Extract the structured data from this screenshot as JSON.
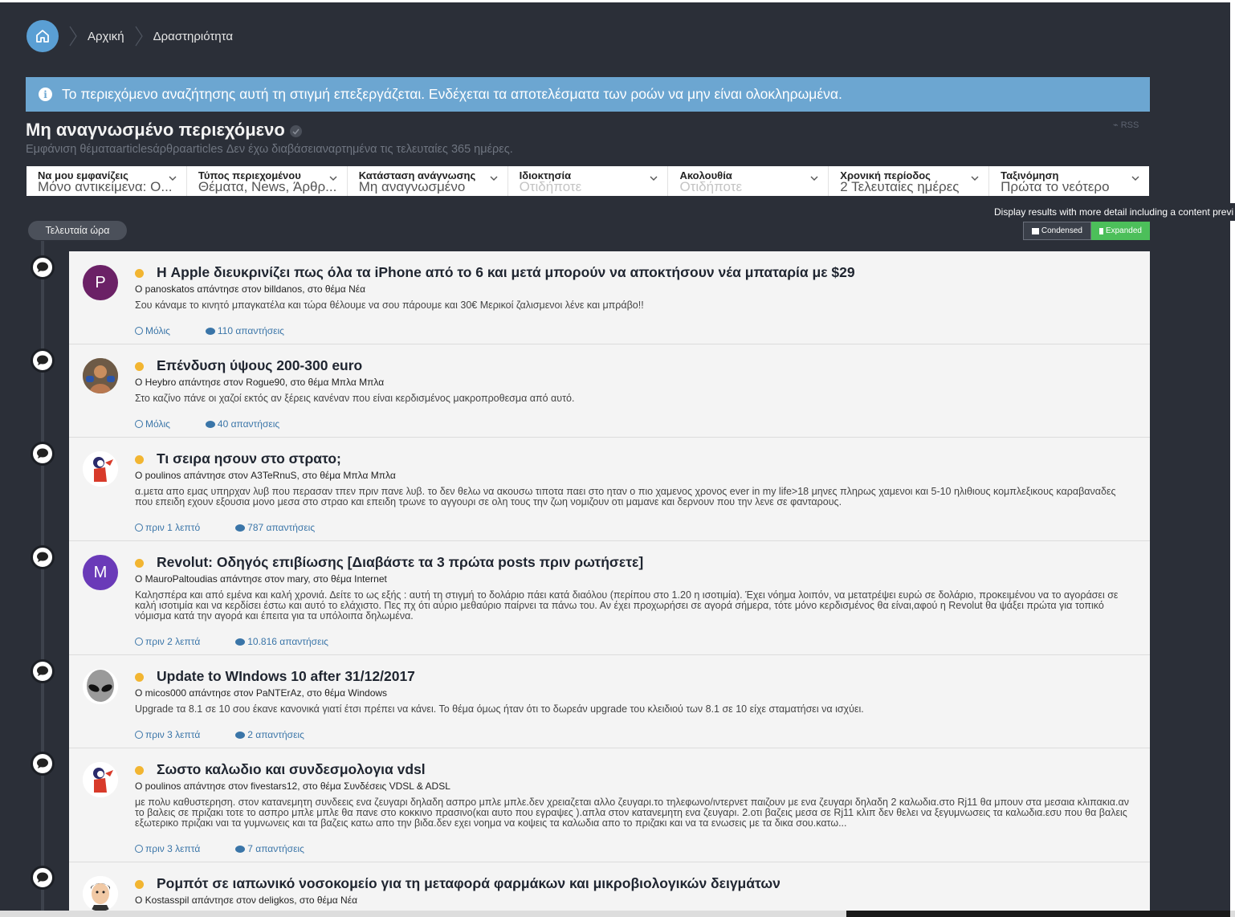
{
  "breadcrumb": {
    "home_icon": "home-icon",
    "items": [
      "Αρχική",
      "Δραστηριότητα"
    ]
  },
  "notice": {
    "icon": "info-icon",
    "text": "Το περιεχόμενο αναζήτησης αυτή τη στιγμή επεξεργάζεται. Ενδέχεται τα αποτελέσματα των ροών να μην είναι ολοκληρωμένα."
  },
  "page": {
    "title": "Μη αναγνωσμένο περιεχόμενο",
    "rss": "RSS",
    "subtitle": "Εμφάνιση θέματαarticlesάρθραarticles Δεν έχω διαβάσειαναρτημένα τις τελευταίες 365 ημέρες."
  },
  "filters": [
    {
      "label": "Να μου εμφανίζεις",
      "value": "Μόνο αντικείμενα: Ο...",
      "muted": false
    },
    {
      "label": "Τύπος περιεχομένου",
      "value": "Θέματα, News, Άρθρ...",
      "muted": false
    },
    {
      "label": "Κατάσταση ανάγνωσης",
      "value": "Μη αναγνωσμένο",
      "muted": false
    },
    {
      "label": "Ιδιοκτησία",
      "value": "Οτιδήποτε",
      "muted": true
    },
    {
      "label": "Ακολουθία",
      "value": "Οτιδήποτε",
      "muted": true
    },
    {
      "label": "Χρονική περίοδος",
      "value": "2 Τελευταίες ημέρες",
      "muted": false
    },
    {
      "label": "Ταξινόμηση",
      "value": "Πρώτα το νεότερο",
      "muted": false
    }
  ],
  "tooltip": "Display results with more detail including a content previ",
  "view_toggle": {
    "condensed": "Condensed",
    "expanded": "Expanded",
    "active": "expanded"
  },
  "time_group": "Τελευταία ώρα",
  "colors": {
    "accent": "#5a9fd4",
    "unread": "#f2b531",
    "link": "#3a75a8",
    "expanded": "#4cbf5a"
  },
  "items": [
    {
      "avatar_letter": "P",
      "avatar_color": "#6b2166",
      "title": "Η Apple διευκρινίζει πως όλα τα iPhone από το 6 και μετά μπορούν να αποκτήσουν νέα μπαταρία με $29",
      "meta": "Ο panoskatos απάντησε στον billdanos, στο θέμα Νέα",
      "snippet": "Σου κάναμε το κινητό μπαγκατέλα και τώρα θέλουμε να σου πάρουμε και 30€ Μερικοί ζαλισμενοι λένε και μπράβο!!",
      "time": "Μόλις",
      "replies": "110 απαντήσεις"
    },
    {
      "avatar_letter": "",
      "avatar_color": "#8a6a4a",
      "avatar_icon": "user-photo-icon",
      "title": "Επένδυση ύψους 200-300 euro",
      "meta": "Ο Heybro απάντησε στον Rogue90, στο θέμα Μπλα Μπλα",
      "snippet": "Στο καζίνο πάνε οι χαζοί εκτός αν ξέρεις κανέναν που είναι κερδισμένος μακροπροθεσμα από αυτό.",
      "time": "Μόλις",
      "replies": "40 απαντήσεις"
    },
    {
      "avatar_letter": "",
      "avatar_color": "#ffffff",
      "avatar_icon": "cartoon-avatar-icon",
      "title": "Τι σειρα ησουν στο στρατο;",
      "meta": "Ο poulinos απάντησε στον A3TeRnuS, στο θέμα Μπλα Μπλα",
      "snippet": "α.μετα απο εμας υπηρχαν λυβ που περασαν τπεν πριν πανε λυβ. το δεν θελω να ακουσω τιποτα παει στο ηταν ο πιο χαμενος χρονος ever in my life>18 μηνες πληρως χαμενοι και 5-10 ηλιθιους κομπλεξικους καραβαναδες που επειδη εχουν εξουσια μονο μεσα στο στραο και επειδη τρωνε το αγγουρι σε ολη τους την ζωη νομιζουν οτι μαμανε και δερνουν που την λενε σε φανταρους.",
      "time": "πριν 1 λεπτό",
      "replies": "787 απαντήσεις"
    },
    {
      "avatar_letter": "M",
      "avatar_color": "#6a3ab8",
      "title": "Revolut: Οδηγός επιβίωσης [Διαβάστε τα 3 πρώτα posts πριν ρωτήσετε]",
      "meta": "Ο MauroPaltoudias απάντησε στον mary, στο θέμα Internet",
      "snippet": "Καλησπέρα και από εμένα και καλή χρονιά. Δείτε το ως εξής : αυτή τη στιγμή το δολάριο πάει κατά διαόλου (περίπου στο 1.20 η ισοτιμία). Έχει νόημα λοιπόν, να μετατρέψει ευρώ σε δολάριο, προκειμένου να το αγοράσει σε καλή ισοτιμία και να κερδίσει έστω και αυτό το ελάχιστο. Πες πχ ότι αύριο μεθαύριο παίρνει τα πάνω του. Αν έχει προχωρήσει σε αγορά σήμερα, τότε μόνο κερδισμένος θα είναι,αφού η Revolut θα ψάξει πρώτα για τοπικό νόμισμα κατά την αγορά και έπειτα για τα υπόλοιπα δηλωμένα.",
      "time": "πριν 2 λεπτά",
      "replies": "10.816 απαντήσεις"
    },
    {
      "avatar_letter": "",
      "avatar_color": "#ffffff",
      "avatar_icon": "alien-avatar-icon",
      "title": "Update to WIndows 10 after 31/12/2017",
      "meta": "Ο micos000 απάντησε στον PaNTErAz, στο θέμα Windows",
      "snippet": "Upgrade τα 8.1 σε 10 σου έκανε κανονικά γιατί έτσι πρέπει να κάνει. Το θέμα όμως ήταν ότι το δωρεάν upgrade του κλειδιού των 8.1 σε 10 είχε σταματήσει να ισχύει.",
      "time": "πριν 3 λεπτά",
      "replies": "2 απαντήσεις"
    },
    {
      "avatar_letter": "",
      "avatar_color": "#ffffff",
      "avatar_icon": "cartoon-avatar-icon",
      "title": "Σωστο καλωδιο και συνδεσμολογια vdsl",
      "meta": "Ο poulinos απάντησε στον fivestars12, στο θέμα Συνδέσεις VDSL & ADSL",
      "snippet": "με πολυ καθυστερηση. στον κατανεμητη συνδεεις ενα ζευγαρι δηλαδη ασπρο μπλε μπλε.δεν χρειαζεται αλλο ζευγαρι.το τηλεφωνο/ιντερνετ παιζουν με ενα ζευγαρι δηλαδη 2 καλωδια.στο Rj11 θα μπουν στα μεσαια κλιπακια.αν το βαλεις σε πριζακι τοτε το ασπρο μπλε μπλε θα πανε στο κοκκινο πρασινο(και αυτο που εγραψες ).απλα στον κατανεμητη ενα ζευγαρι. 2.οτι βαζεις μεσα σε Rj11 κλιπ δεν θελει να ξεγυμνωσεις τα καλωδια.εσυ που θα βαλεις εξωτερικο πριζακι ναι τα γυμνωνεις και τα βαζεις κατω απο την βιδα.δεν εχει νοημα να κοψεις τα καλωδια απο το πριζακι και να τα ενωσεις με τα δικα σου.κατω...",
      "time": "πριν 3 λεπτά",
      "replies": "7 απαντήσεις"
    },
    {
      "avatar_letter": "",
      "avatar_color": "#ffffff",
      "avatar_icon": "cartoon-face-icon",
      "title": "Ρομπότ σε ιαπωνικό νοσοκομείο για τη μεταφορά φαρμάκων και μικροβιολογικών δειγμάτων",
      "meta": "Ο Kostasspil απάντησε στον deligkos, στο θέμα Νέα",
      "snippet": "",
      "time": "",
      "replies": ""
    }
  ]
}
